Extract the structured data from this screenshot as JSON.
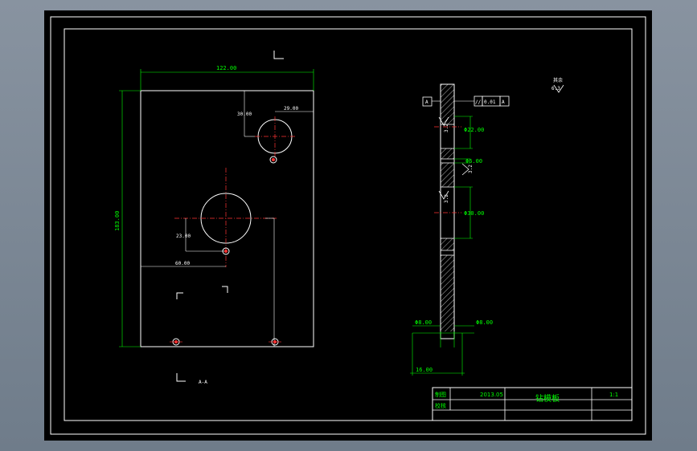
{
  "front_view": {
    "dims": {
      "width": "122.00",
      "height": "183.00",
      "d1": "30.00",
      "d2": "29.00",
      "d3": "23.00",
      "d4": "60.00"
    },
    "section_label": "A-A"
  },
  "side_view": {
    "datum": "A",
    "tolerance": {
      "symbol": "//",
      "value": "0.01",
      "datum": "A"
    },
    "dims": {
      "top_dia": "Φ22.00",
      "gap": "Φ6.00",
      "mid_dia": "Φ30.00",
      "left_bottom": "Φ8.00",
      "right_bottom": "Φ8.00",
      "thickness": "16.00"
    },
    "roughness": [
      "3.2",
      "3.2",
      "3.2"
    ]
  },
  "roughness_note": {
    "label": "其余",
    "value": "6.3"
  },
  "title_block": {
    "row1_label": "制图",
    "row1_value": "2013.05",
    "row2_label": "校核",
    "part_name": "钻模板",
    "scale": "1:1"
  }
}
